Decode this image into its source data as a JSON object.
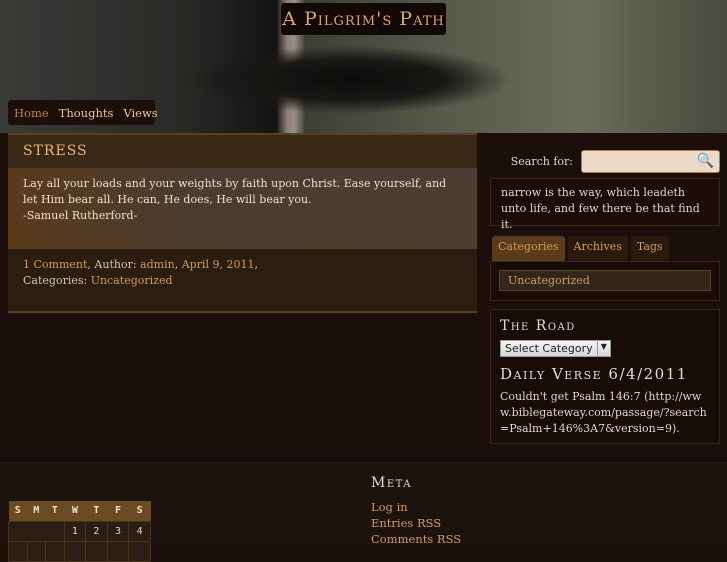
{
  "site": {
    "title": "A Pilgrim's Path"
  },
  "nav": [
    "Home",
    "Thoughts",
    "Views"
  ],
  "post": {
    "title": "STRESS",
    "body_lines": [
      "Lay all your loads and your weights by faith upon Christ. Ease yourself, and let Him bear all. He can, He does, He will bear you.",
      "-Samuel Rutherford-"
    ],
    "comments": "1 Comment",
    "author_label": ", Author: ",
    "author": "admin",
    "date": "April 9, 2011",
    "categories_label": "Categories: ",
    "category": "Uncategorized"
  },
  "sidebar": {
    "search_label": "Search for:",
    "search_value": "",
    "quote": "narrow is the way, which leadeth unto life, and few there be that find it.",
    "tabs": [
      "Categories",
      "Archives",
      "Tags"
    ],
    "category_item": "Uncategorized",
    "road_title": "The Road",
    "select_value": "Select Category",
    "verse_title": "Daily Verse 6/4/2011",
    "verse_text": "Couldn't get Psalm 146:7 (http://www.biblegateway.com/passage/?search=Psalm+146%3A7&version=9)."
  },
  "calendar": {
    "days": [
      "S",
      "M",
      "T",
      "W",
      "T",
      "F",
      "S"
    ],
    "row1": [
      "",
      "",
      "",
      "1",
      "2",
      "3",
      "4"
    ]
  },
  "meta": {
    "title": "Meta",
    "links": [
      "Log in",
      "Entries RSS",
      "Comments RSS"
    ]
  }
}
